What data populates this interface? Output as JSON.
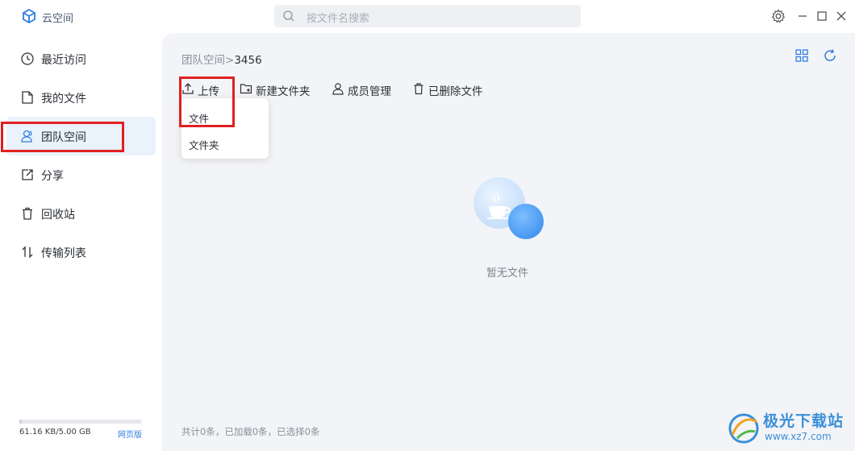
{
  "window": {
    "title": "云空间"
  },
  "search": {
    "placeholder": "按文件名搜索"
  },
  "sidebar": {
    "items": [
      {
        "label": "最近访问",
        "icon": "clock-icon"
      },
      {
        "label": "我的文件",
        "icon": "file-icon"
      },
      {
        "label": "团队空间",
        "icon": "team-icon",
        "active": true
      },
      {
        "label": "分享",
        "icon": "share-icon"
      },
      {
        "label": "回收站",
        "icon": "trash-icon"
      },
      {
        "label": "传输列表",
        "icon": "transfer-icon"
      }
    ],
    "storage": {
      "text": "61.16 KB/5.00 GB",
      "used_fraction": 0.02
    },
    "web_link": "网页版"
  },
  "main": {
    "breadcrumb": {
      "parent": "团队空间",
      "separator": ">",
      "current": "3456"
    },
    "toolbar": {
      "upload": "上传",
      "new_folder": "新建文件夹",
      "members": "成员管理",
      "deleted": "已删除文件"
    },
    "upload_menu": [
      "文件",
      "文件夹"
    ],
    "empty_text": "暂无文件",
    "status": "共计0条，已加载0条，已选择0条"
  },
  "watermark": {
    "text": "极光下载站",
    "url": "www.xz7.com"
  },
  "colors": {
    "accent": "#2e7de1",
    "highlight": "#e02020",
    "active_bg": "#eaf2fb"
  }
}
